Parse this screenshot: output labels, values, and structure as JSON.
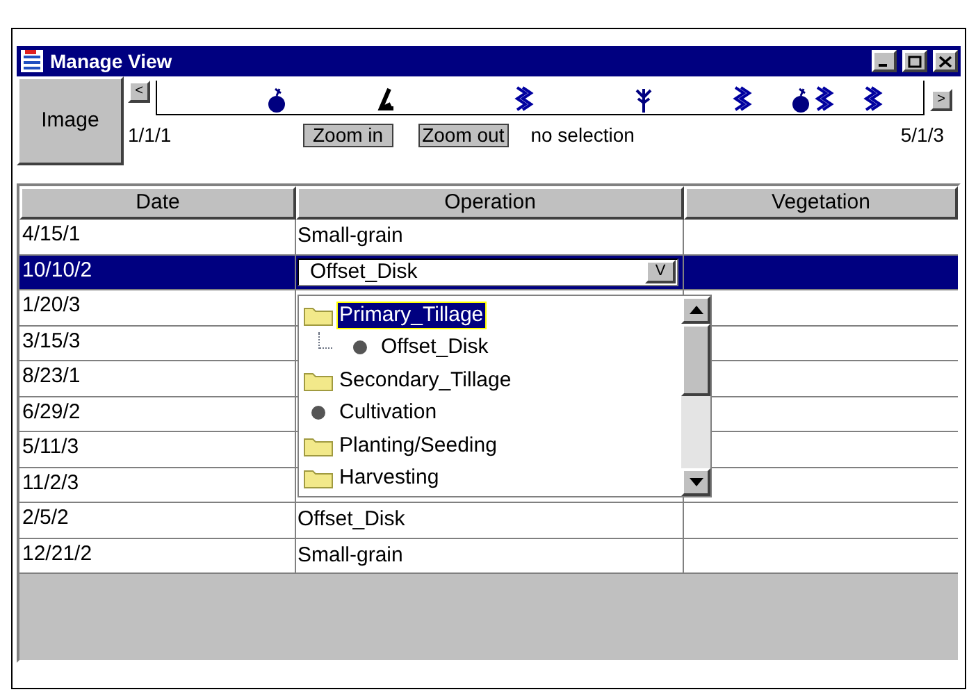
{
  "window": {
    "title": "Manage View"
  },
  "toolbar": {
    "image_button": "Image",
    "prev": "<",
    "next": ">",
    "start": "1/1/1",
    "end": "5/1/3",
    "zoom_in": "Zoom in",
    "zoom_out": "Zoom out",
    "selection": "no selection",
    "events": [
      {
        "kind": "bomb"
      },
      {
        "kind": "hook"
      },
      {
        "kind": "wave"
      },
      {
        "kind": "plant"
      },
      {
        "kind": "wave"
      },
      {
        "kind": "bomb"
      },
      {
        "kind": "wave"
      },
      {
        "kind": "wave"
      }
    ]
  },
  "table": {
    "columns": [
      "Date",
      "Operation",
      "Vegetation"
    ],
    "rows": [
      {
        "date": "4/15/1",
        "operation": "Small-grain",
        "selected": false
      },
      {
        "date": "10/10/2",
        "selected": true,
        "editor": {
          "value": "Offset_Disk",
          "button": "V"
        }
      },
      {
        "date": "1/20/3",
        "selected": false
      },
      {
        "date": "3/15/3",
        "selected": false
      },
      {
        "date": "8/23/1",
        "selected": false
      },
      {
        "date": "6/29/2",
        "selected": false
      },
      {
        "date": "5/11/3",
        "selected": false
      },
      {
        "date": "11/2/3",
        "selected": false
      },
      {
        "date": "2/5/2",
        "operation": "Offset_Disk",
        "selected": false
      },
      {
        "date": "12/21/2",
        "operation": "Small-grain",
        "selected": false
      }
    ]
  },
  "dropdown": {
    "items": [
      {
        "label": "Primary_Tillage",
        "kind": "folder",
        "selected": true,
        "children": [
          {
            "label": "Offset_Disk",
            "kind": "leaf",
            "selected": false
          }
        ]
      },
      {
        "label": "Secondary_Tillage",
        "kind": "folder",
        "selected": false
      },
      {
        "label": "Cultivation",
        "kind": "leaf",
        "selected": false
      },
      {
        "label": "Planting/Seeding",
        "kind": "folder",
        "selected": false
      },
      {
        "label": "Harvesting",
        "kind": "folder",
        "selected": false
      }
    ]
  }
}
